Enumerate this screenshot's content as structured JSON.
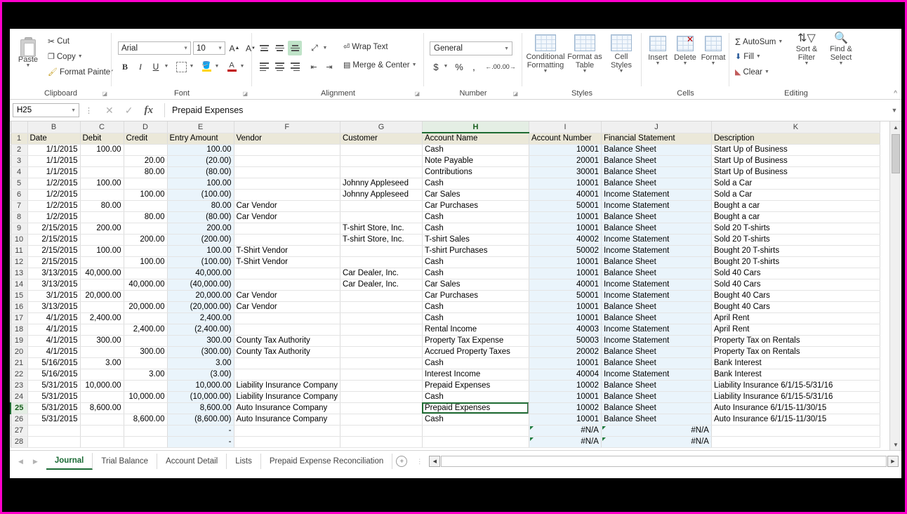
{
  "ribbon": {
    "clipboard": {
      "label": "Clipboard",
      "paste": "Paste",
      "cut": "Cut",
      "copy": "Copy",
      "format_painter": "Format Painter"
    },
    "font": {
      "label": "Font",
      "font_name": "Arial",
      "font_size": "10",
      "grow_font": "A",
      "shrink_font": "A",
      "bold": "B",
      "italic": "I",
      "underline": "U"
    },
    "alignment": {
      "label": "Alignment",
      "wrap_text": "Wrap Text",
      "merge_center": "Merge & Center"
    },
    "number": {
      "label": "Number",
      "format": "General",
      "currency": "$",
      "percent": "%",
      "comma": ","
    },
    "styles": {
      "label": "Styles",
      "conditional_formatting": "Conditional Formatting",
      "format_as_table": "Format as Table",
      "cell_styles": "Cell Styles"
    },
    "cells": {
      "label": "Cells",
      "insert": "Insert",
      "delete": "Delete",
      "format": "Format"
    },
    "editing": {
      "label": "Editing",
      "autosum": "AutoSum",
      "fill": "Fill",
      "clear": "Clear",
      "sort_filter": "Sort & Filter",
      "find_select": "Find & Select"
    }
  },
  "formula_bar": {
    "name_box": "H25",
    "value": "Prepaid Expenses",
    "cancel_icon": "cancel-icon",
    "enter_icon": "check-icon",
    "fx": "fx"
  },
  "grid": {
    "columns": [
      "B",
      "C",
      "D",
      "E",
      "F",
      "G",
      "H",
      "I",
      "J",
      "K"
    ],
    "active_column": "H",
    "active_row": 25,
    "headers": [
      "Date",
      "Debit",
      "Credit",
      "Entry Amount",
      "Vendor",
      "Customer",
      "Account Name",
      "Account Number",
      "Financial Statement",
      "Description"
    ],
    "rows": [
      {
        "n": 2,
        "date": "1/1/2015",
        "debit": "100.00",
        "credit": "",
        "entry": "100.00",
        "vendor": "",
        "customer": "",
        "account": "Cash",
        "acctnum": "10001",
        "stmt": "Balance Sheet",
        "desc": "Start Up of Business"
      },
      {
        "n": 3,
        "date": "1/1/2015",
        "debit": "",
        "credit": "20.00",
        "entry": "(20.00)",
        "vendor": "",
        "customer": "",
        "account": "Note Payable",
        "acctnum": "20001",
        "stmt": "Balance Sheet",
        "desc": "Start Up of Business"
      },
      {
        "n": 4,
        "date": "1/1/2015",
        "debit": "",
        "credit": "80.00",
        "entry": "(80.00)",
        "vendor": "",
        "customer": "",
        "account": "Contributions",
        "acctnum": "30001",
        "stmt": "Balance Sheet",
        "desc": "Start Up of Business"
      },
      {
        "n": 5,
        "date": "1/2/2015",
        "debit": "100.00",
        "credit": "",
        "entry": "100.00",
        "vendor": "",
        "customer": "Johnny Appleseed",
        "account": "Cash",
        "acctnum": "10001",
        "stmt": "Balance Sheet",
        "desc": "Sold a Car"
      },
      {
        "n": 6,
        "date": "1/2/2015",
        "debit": "",
        "credit": "100.00",
        "entry": "(100.00)",
        "vendor": "",
        "customer": "Johnny Appleseed",
        "account": "Car Sales",
        "acctnum": "40001",
        "stmt": "Income Statement",
        "desc": "Sold a Car"
      },
      {
        "n": 7,
        "date": "1/2/2015",
        "debit": "80.00",
        "credit": "",
        "entry": "80.00",
        "vendor": "Car Vendor",
        "customer": "",
        "account": "Car Purchases",
        "acctnum": "50001",
        "stmt": "Income Statement",
        "desc": "Bought a car"
      },
      {
        "n": 8,
        "date": "1/2/2015",
        "debit": "",
        "credit": "80.00",
        "entry": "(80.00)",
        "vendor": "Car Vendor",
        "customer": "",
        "account": "Cash",
        "acctnum": "10001",
        "stmt": "Balance Sheet",
        "desc": "Bought a car"
      },
      {
        "n": 9,
        "date": "2/15/2015",
        "debit": "200.00",
        "credit": "",
        "entry": "200.00",
        "vendor": "",
        "customer": "T-shirt Store, Inc.",
        "account": "Cash",
        "acctnum": "10001",
        "stmt": "Balance Sheet",
        "desc": "Sold 20 T-shirts"
      },
      {
        "n": 10,
        "date": "2/15/2015",
        "debit": "",
        "credit": "200.00",
        "entry": "(200.00)",
        "vendor": "",
        "customer": "T-shirt Store, Inc.",
        "account": "T-shirt Sales",
        "acctnum": "40002",
        "stmt": "Income Statement",
        "desc": "Sold 20 T-shirts"
      },
      {
        "n": 11,
        "date": "2/15/2015",
        "debit": "100.00",
        "credit": "",
        "entry": "100.00",
        "vendor": "T-Shirt Vendor",
        "customer": "",
        "account": "T-shirt Purchases",
        "acctnum": "50002",
        "stmt": "Income Statement",
        "desc": "Bought 20 T-shirts"
      },
      {
        "n": 12,
        "date": "2/15/2015",
        "debit": "",
        "credit": "100.00",
        "entry": "(100.00)",
        "vendor": "T-Shirt Vendor",
        "customer": "",
        "account": "Cash",
        "acctnum": "10001",
        "stmt": "Balance Sheet",
        "desc": "Bought 20 T-shirts"
      },
      {
        "n": 13,
        "date": "3/13/2015",
        "debit": "40,000.00",
        "credit": "",
        "entry": "40,000.00",
        "vendor": "",
        "customer": "Car Dealer, Inc.",
        "account": "Cash",
        "acctnum": "10001",
        "stmt": "Balance Sheet",
        "desc": "Sold 40 Cars"
      },
      {
        "n": 14,
        "date": "3/13/2015",
        "debit": "",
        "credit": "40,000.00",
        "entry": "(40,000.00)",
        "vendor": "",
        "customer": "Car Dealer, Inc.",
        "account": "Car Sales",
        "acctnum": "40001",
        "stmt": "Income Statement",
        "desc": "Sold 40 Cars"
      },
      {
        "n": 15,
        "date": "3/1/2015",
        "debit": "20,000.00",
        "credit": "",
        "entry": "20,000.00",
        "vendor": "Car Vendor",
        "customer": "",
        "account": "Car Purchases",
        "acctnum": "50001",
        "stmt": "Income Statement",
        "desc": "Bought 40 Cars"
      },
      {
        "n": 16,
        "date": "3/13/2015",
        "debit": "",
        "credit": "20,000.00",
        "entry": "(20,000.00)",
        "vendor": "Car Vendor",
        "customer": "",
        "account": "Cash",
        "acctnum": "10001",
        "stmt": "Balance Sheet",
        "desc": "Bought 40 Cars"
      },
      {
        "n": 17,
        "date": "4/1/2015",
        "debit": "2,400.00",
        "credit": "",
        "entry": "2,400.00",
        "vendor": "",
        "customer": "",
        "account": "Cash",
        "acctnum": "10001",
        "stmt": "Balance Sheet",
        "desc": "April Rent"
      },
      {
        "n": 18,
        "date": "4/1/2015",
        "debit": "",
        "credit": "2,400.00",
        "entry": "(2,400.00)",
        "vendor": "",
        "customer": "",
        "account": "Rental Income",
        "acctnum": "40003",
        "stmt": "Income Statement",
        "desc": "April Rent"
      },
      {
        "n": 19,
        "date": "4/1/2015",
        "debit": "300.00",
        "credit": "",
        "entry": "300.00",
        "vendor": "County Tax Authority",
        "customer": "",
        "account": "Property Tax Expense",
        "acctnum": "50003",
        "stmt": "Income Statement",
        "desc": "Property Tax on Rentals"
      },
      {
        "n": 20,
        "date": "4/1/2015",
        "debit": "",
        "credit": "300.00",
        "entry": "(300.00)",
        "vendor": "County Tax Authority",
        "customer": "",
        "account": "Accrued Property Taxes",
        "acctnum": "20002",
        "stmt": "Balance Sheet",
        "desc": "Property Tax on Rentals"
      },
      {
        "n": 21,
        "date": "5/16/2015",
        "debit": "3.00",
        "credit": "",
        "entry": "3.00",
        "vendor": "",
        "customer": "",
        "account": "Cash",
        "acctnum": "10001",
        "stmt": "Balance Sheet",
        "desc": "Bank Interest"
      },
      {
        "n": 22,
        "date": "5/16/2015",
        "debit": "",
        "credit": "3.00",
        "entry": "(3.00)",
        "vendor": "",
        "customer": "",
        "account": "Interest Income",
        "acctnum": "40004",
        "stmt": "Income Statement",
        "desc": "Bank Interest"
      },
      {
        "n": 23,
        "date": "5/31/2015",
        "debit": "10,000.00",
        "credit": "",
        "entry": "10,000.00",
        "vendor": "Liability Insurance Company",
        "customer": "",
        "account": "Prepaid Expenses",
        "acctnum": "10002",
        "stmt": "Balance Sheet",
        "desc": "Liability Insurance 6/1/15-5/31/16"
      },
      {
        "n": 24,
        "date": "5/31/2015",
        "debit": "",
        "credit": "10,000.00",
        "entry": "(10,000.00)",
        "vendor": "Liability Insurance Company",
        "customer": "",
        "account": "Cash",
        "acctnum": "10001",
        "stmt": "Balance Sheet",
        "desc": "Liability Insurance 6/1/15-5/31/16"
      },
      {
        "n": 25,
        "date": "5/31/2015",
        "debit": "8,600.00",
        "credit": "",
        "entry": "8,600.00",
        "vendor": "Auto Insurance Company",
        "customer": "",
        "account": "Prepaid Expenses",
        "acctnum": "10002",
        "stmt": "Balance Sheet",
        "desc": "Auto Insurance 6/1/15-11/30/15"
      },
      {
        "n": 26,
        "date": "5/31/2015",
        "debit": "",
        "credit": "8,600.00",
        "entry": "(8,600.00)",
        "vendor": "Auto Insurance Company",
        "customer": "",
        "account": "Cash",
        "acctnum": "10001",
        "stmt": "Balance Sheet",
        "desc": "Auto Insurance 6/1/15-11/30/15"
      },
      {
        "n": 27,
        "date": "",
        "debit": "",
        "credit": "",
        "entry": "-",
        "vendor": "",
        "customer": "",
        "account": "",
        "acctnum": "#N/A",
        "stmt": "#N/A",
        "desc": ""
      },
      {
        "n": 28,
        "date": "",
        "debit": "",
        "credit": "",
        "entry": "-",
        "vendor": "",
        "customer": "",
        "account": "",
        "acctnum": "#N/A",
        "stmt": "#N/A",
        "desc": ""
      }
    ]
  },
  "sheet_tabs": {
    "tabs": [
      "Journal",
      "Trial Balance",
      "Account Detail",
      "Lists",
      "Prepaid Expense Reconciliation"
    ],
    "active": "Journal",
    "add_label": "+"
  }
}
